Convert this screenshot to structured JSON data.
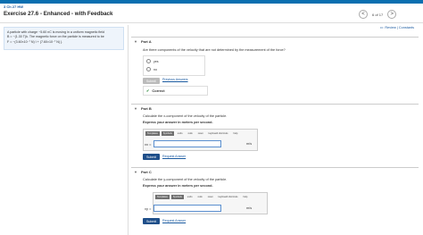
{
  "header": {
    "course": "3 Ch 27 HW",
    "title": "Exercise 27.6 - Enhanced - with Feedback",
    "nav": {
      "prev": "<",
      "count": "6 of 17",
      "next": ">"
    },
    "review": "Review | Constants"
  },
  "problem": {
    "line1": "A particle with charge −5.60 nC is moving in a uniform magnetic field",
    "line2": "B = −(1.30 T)k. The magnetic force on the particle is measured to be",
    "line3": "F = −(3.60×10⁻⁷ N) î + (7.60×10⁻⁷ N) ĵ."
  },
  "partA": {
    "label": "Part A",
    "question": "Are there components of the velocity that are not determined by the measurement of the force?",
    "options": [
      "yes",
      "no"
    ],
    "submit": "Submit",
    "prev": "Previous Answers",
    "feedback": "Correct"
  },
  "partB": {
    "label": "Part B",
    "question": "Calculate the x-component of the velocity of the particle.",
    "instruction": "Express your answer in meters per second.",
    "tools": [
      "Templates",
      "Symbols",
      "undo",
      "redo",
      "reset",
      "keyboard shortcuts",
      "help"
    ],
    "var": "vx =",
    "unit": "m/s",
    "submit": "Submit",
    "request": "Request Answer"
  },
  "partC": {
    "label": "Part C",
    "question": "Calculate the y-component of the velocity of the particle.",
    "instruction": "Express your answer in meters per second.",
    "tools": [
      "Templates",
      "Symbols",
      "undo",
      "redo",
      "reset",
      "keyboard shortcuts",
      "help"
    ],
    "var": "vy =",
    "unit": "m/s",
    "submit": "Submit",
    "request": "Request Answer"
  }
}
